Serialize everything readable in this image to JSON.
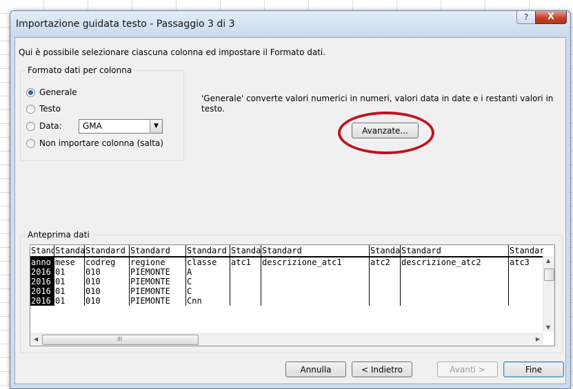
{
  "dialog": {
    "title": "Importazione guidata testo - Passaggio 3 di 3",
    "help_glyph": "?",
    "close_glyph": "X",
    "intro": "Qui è possibile selezionare ciascuna colonna ed impostare il Formato dati."
  },
  "format": {
    "legend": "Formato dati per colonna",
    "options": [
      {
        "label": "Generale",
        "checked": true
      },
      {
        "label": "Testo",
        "checked": false
      },
      {
        "label": "Data:",
        "checked": false
      },
      {
        "label": "Non importare colonna (salta)",
        "checked": false
      }
    ],
    "date_value": "GMA",
    "description": "'Generale' converte valori numerici in numeri, valori data in date e i restanti valori in testo.",
    "advanced_label": "Avanzate..."
  },
  "preview": {
    "legend": "Anteprima dati",
    "headers": [
      "Standard",
      "Standard",
      "Standard",
      "Standard",
      "Standard",
      "Standard",
      "Standard",
      "Standard",
      "Standard",
      "Standard"
    ],
    "rows": [
      [
        "anno",
        "mese",
        "codreg",
        "regione",
        "classe",
        "atc1",
        "descrizione_atc1",
        "atc2",
        "descrizione_atc2",
        "atc3"
      ],
      [
        "2016",
        "01",
        "010",
        "PIEMONTE",
        "A",
        "",
        "",
        "",
        "",
        ""
      ],
      [
        "2016",
        "01",
        "010",
        "PIEMONTE",
        "C",
        "",
        "",
        "",
        "",
        ""
      ],
      [
        "2016",
        "01",
        "010",
        "PIEMONTE",
        "C",
        "",
        "",
        "",
        "",
        ""
      ],
      [
        "2016",
        "01",
        "010",
        "PIEMONTE",
        "Cnn",
        "",
        "",
        "",
        "",
        ""
      ]
    ],
    "grip_glyph": "III"
  },
  "footer": {
    "cancel": "Annulla",
    "back": "< Indietro",
    "next": "Avanti >",
    "finish": "Fine"
  },
  "colors": {
    "annotation": "#c1121e",
    "selection": "#000000"
  }
}
